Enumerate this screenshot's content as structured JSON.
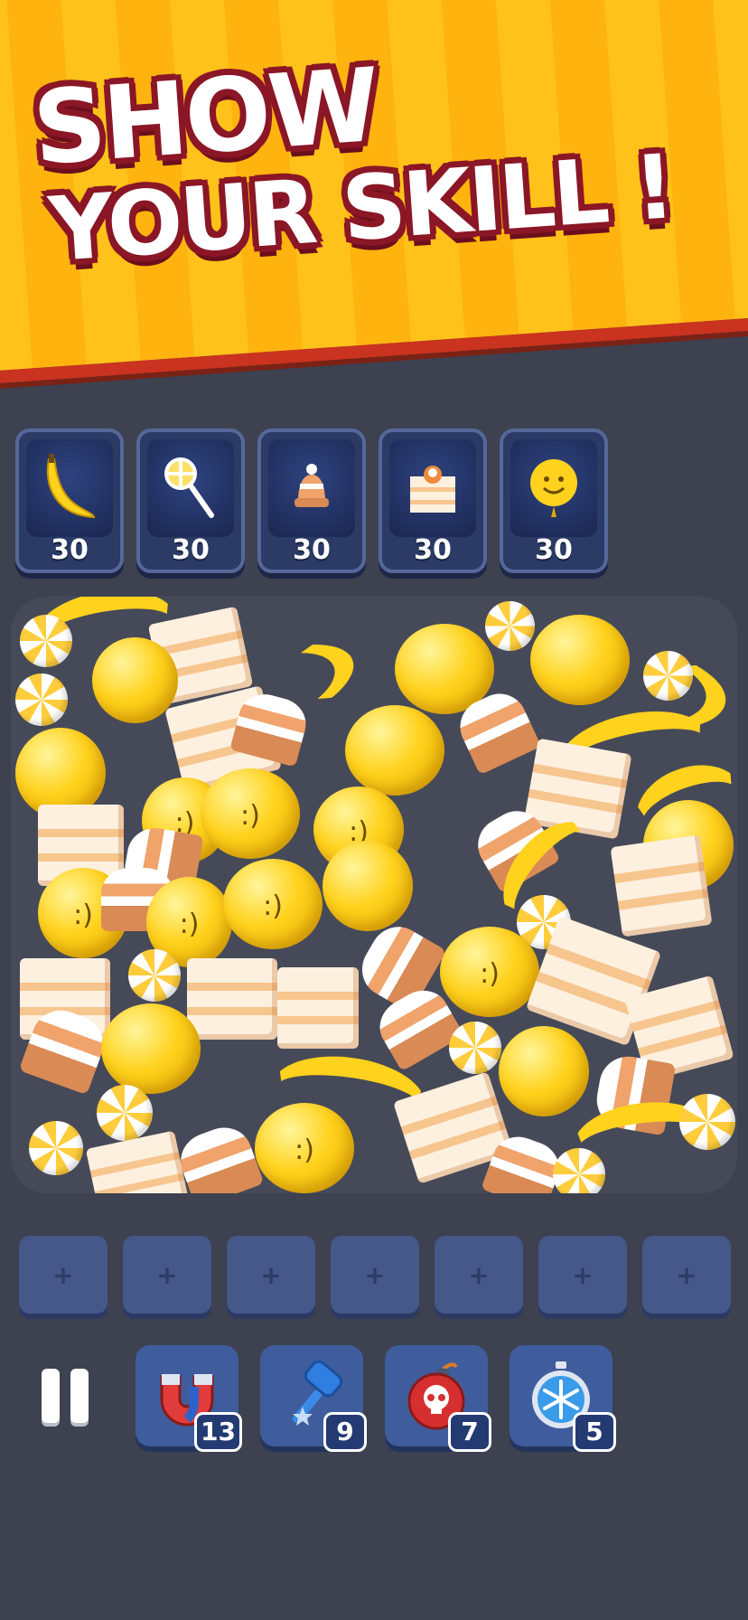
{
  "banner": {
    "line1": "SHOW",
    "line2": "YOUR SKILL !"
  },
  "goals": [
    {
      "icon": "banana-icon",
      "count": "30"
    },
    {
      "icon": "lollipop-icon",
      "count": "30"
    },
    {
      "icon": "bell-icon",
      "count": "30"
    },
    {
      "icon": "cake-icon",
      "count": "30"
    },
    {
      "icon": "smiley-balloon-icon",
      "count": "30"
    }
  ],
  "slots": {
    "empty_symbol": "+",
    "count": 7
  },
  "boosters": [
    {
      "icon": "magnet-icon",
      "count": "13"
    },
    {
      "icon": "hammer-icon",
      "count": "9"
    },
    {
      "icon": "skull-bomb-icon",
      "count": "7"
    },
    {
      "icon": "freeze-timer-icon",
      "count": "5"
    }
  ],
  "colors": {
    "banner": "#ffc21a",
    "banner_border": "#c9331f",
    "background": "#3d4150",
    "tile": "#46578a"
  }
}
